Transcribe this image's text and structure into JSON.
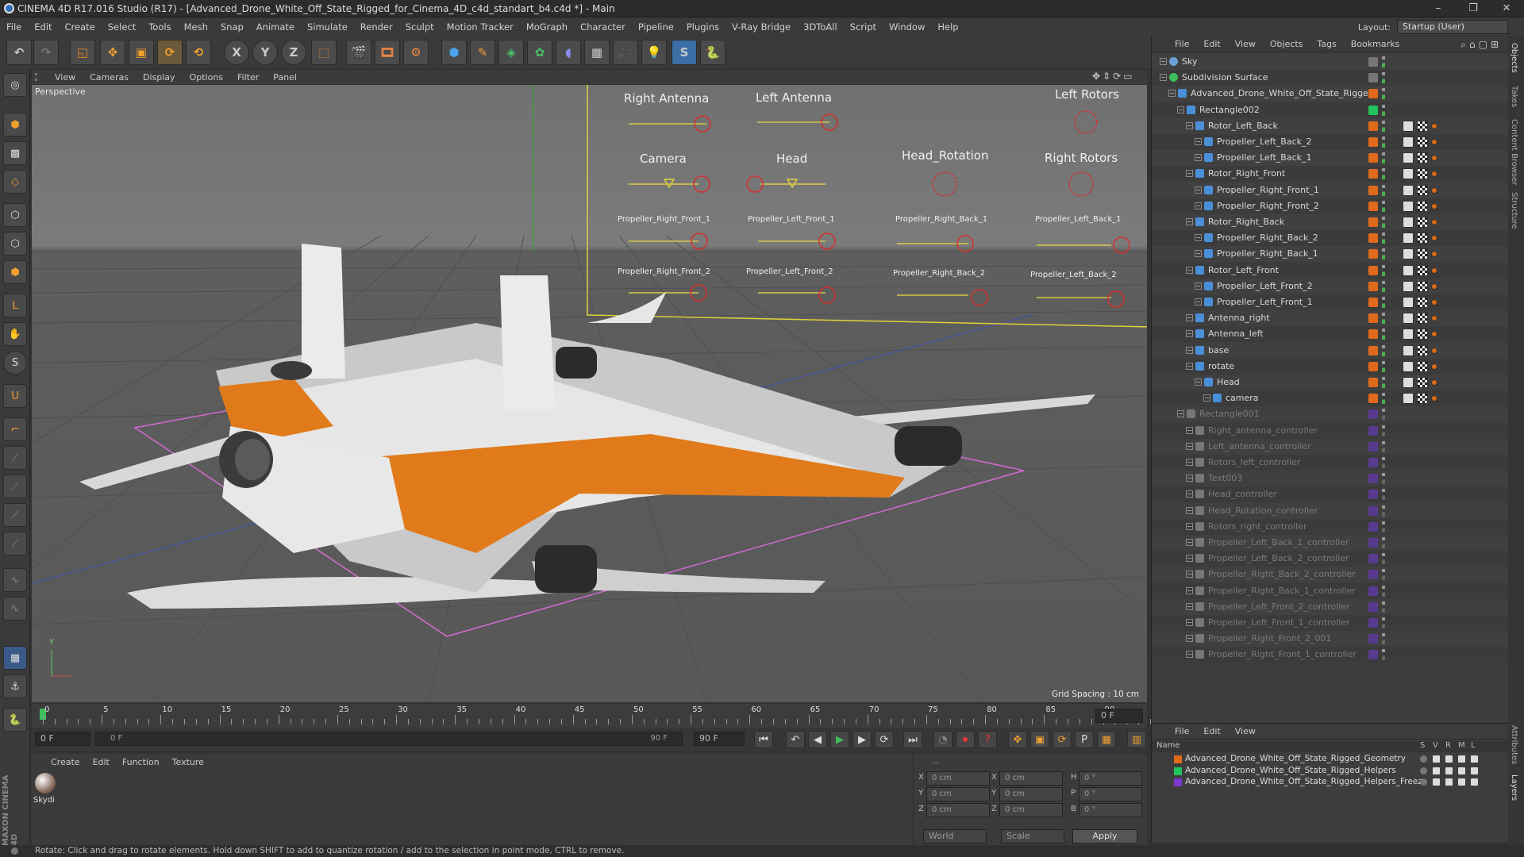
{
  "window": {
    "title": "CINEMA 4D R17.016 Studio (R17) - [Advanced_Drone_White_Off_State_Rigged_for_Cinema_4D_c4d_standart_b4.c4d *] - Main",
    "min": "–",
    "max": "❐",
    "close": "✕"
  },
  "menu": [
    "File",
    "Edit",
    "Create",
    "Select",
    "Tools",
    "Mesh",
    "Snap",
    "Animate",
    "Simulate",
    "Render",
    "Sculpt",
    "Motion Tracker",
    "MoGraph",
    "Character",
    "Pipeline",
    "Plugins",
    "V-Ray Bridge",
    "3DToAll",
    "Script",
    "Window",
    "Help"
  ],
  "layout": {
    "label": "Layout:",
    "value": "Startup (User)"
  },
  "toolbar": {
    "x": "X",
    "y": "Y",
    "z": "Z"
  },
  "viewport": {
    "menu": [
      "View",
      "Cameras",
      "Display",
      "Options",
      "Filter",
      "Panel"
    ],
    "label": "Perspective",
    "grid_spacing": "Grid Spacing : 10 cm",
    "axis_y": "Y",
    "controllers": [
      {
        "label": "Right Antenna"
      },
      {
        "label": "Left Antenna"
      },
      {
        "label": "Left Rotors"
      },
      {
        "label": "Camera"
      },
      {
        "label": "Head"
      },
      {
        "label": "Head_Rotation"
      },
      {
        "label": "Right Rotors"
      },
      {
        "label": "Propeller_Right_Front_1"
      },
      {
        "label": "Propeller_Left_Front_1"
      },
      {
        "label": "Propeller_Right_Back_1"
      },
      {
        "label": "Propeller_Left_Back_1"
      },
      {
        "label": "Propeller_Right_Front_2"
      },
      {
        "label": "Propeller_Left_Front_2"
      },
      {
        "label": "Propeller_Right_Back_2"
      },
      {
        "label": "Propeller_Left_Back_2"
      }
    ]
  },
  "timeline": {
    "ticks": [
      "0",
      "5",
      "10",
      "15",
      "20",
      "25",
      "30",
      "35",
      "40",
      "45",
      "50",
      "55",
      "60",
      "65",
      "70",
      "75",
      "80",
      "85",
      "90"
    ],
    "current": "0 F",
    "start": "0 F",
    "range_start": "0 F",
    "range_end": "90 F",
    "end": "90 F"
  },
  "material": {
    "menu": [
      "Create",
      "Edit",
      "Function",
      "Texture"
    ],
    "items": [
      {
        "name": "Skydi"
      }
    ]
  },
  "coords": {
    "header": "--",
    "rows": [
      {
        "a": "X",
        "a_val": "0 cm",
        "b": "X",
        "b_val": "0 cm",
        "c": "H",
        "c_val": "0 °"
      },
      {
        "a": "Y",
        "a_val": "0 cm",
        "b": "Y",
        "b_val": "0 cm",
        "c": "P",
        "c_val": "0 °"
      },
      {
        "a": "Z",
        "a_val": "0 cm",
        "b": "Z",
        "b_val": "0 cm",
        "c": "B",
        "c_val": "0 °"
      }
    ],
    "mode": "World",
    "type": "Scale",
    "apply": "Apply"
  },
  "objects": {
    "menu": [
      "File",
      "Edit",
      "View",
      "Objects",
      "Tags",
      "Bookmarks"
    ],
    "rows": [
      {
        "name": "Sky",
        "indent": 0,
        "dim": false,
        "tag": "none"
      },
      {
        "name": "Subdivision Surface",
        "indent": 0,
        "dim": false,
        "tag": "none"
      },
      {
        "name": "Advanced_Drone_White_Off_State_Rigged",
        "indent": 1,
        "dim": false,
        "tag": "orange"
      },
      {
        "name": "Rectangle002",
        "indent": 2,
        "dim": false,
        "tag": "green"
      },
      {
        "name": "Rotor_Left_Back",
        "indent": 3,
        "dim": false,
        "tag": "orange"
      },
      {
        "name": "Propeller_Left_Back_2",
        "indent": 4,
        "dim": false,
        "tag": "orange"
      },
      {
        "name": "Propeller_Left_Back_1",
        "indent": 4,
        "dim": false,
        "tag": "orange"
      },
      {
        "name": "Rotor_Right_Front",
        "indent": 3,
        "dim": false,
        "tag": "orange"
      },
      {
        "name": "Propeller_Right_Front_1",
        "indent": 4,
        "dim": false,
        "tag": "orange"
      },
      {
        "name": "Propeller_Right_Front_2",
        "indent": 4,
        "dim": false,
        "tag": "orange"
      },
      {
        "name": "Rotor_Right_Back",
        "indent": 3,
        "dim": false,
        "tag": "orange"
      },
      {
        "name": "Propeller_Right_Back_2",
        "indent": 4,
        "dim": false,
        "tag": "orange"
      },
      {
        "name": "Propeller_Right_Back_1",
        "indent": 4,
        "dim": false,
        "tag": "orange"
      },
      {
        "name": "Rotor_Left_Front",
        "indent": 3,
        "dim": false,
        "tag": "orange"
      },
      {
        "name": "Propeller_Left_Front_2",
        "indent": 4,
        "dim": false,
        "tag": "orange"
      },
      {
        "name": "Propeller_Left_Front_1",
        "indent": 4,
        "dim": false,
        "tag": "orange"
      },
      {
        "name": "Antenna_right",
        "indent": 3,
        "dim": false,
        "tag": "orange"
      },
      {
        "name": "Antenna_left",
        "indent": 3,
        "dim": false,
        "tag": "orange"
      },
      {
        "name": "base",
        "indent": 3,
        "dim": false,
        "tag": "orange"
      },
      {
        "name": "rotate",
        "indent": 3,
        "dim": false,
        "tag": "orange"
      },
      {
        "name": "Head",
        "indent": 4,
        "dim": false,
        "tag": "orange"
      },
      {
        "name": "camera",
        "indent": 5,
        "dim": false,
        "tag": "orange"
      },
      {
        "name": "Rectangle001",
        "indent": 2,
        "dim": true,
        "tag": "purple"
      },
      {
        "name": "Right_antenna_controller",
        "indent": 3,
        "dim": true,
        "tag": "purple"
      },
      {
        "name": "Left_antenna_controller",
        "indent": 3,
        "dim": true,
        "tag": "purple"
      },
      {
        "name": "Rotors_left_controller",
        "indent": 3,
        "dim": true,
        "tag": "purple"
      },
      {
        "name": "Text003",
        "indent": 3,
        "dim": true,
        "tag": "purple"
      },
      {
        "name": "Head_controller",
        "indent": 3,
        "dim": true,
        "tag": "purple"
      },
      {
        "name": "Head_Rotation_controller",
        "indent": 3,
        "dim": true,
        "tag": "purple"
      },
      {
        "name": "Rotors_right_controller",
        "indent": 3,
        "dim": true,
        "tag": "purple"
      },
      {
        "name": "Propeller_Left_Back_1_controller",
        "indent": 3,
        "dim": true,
        "tag": "purple"
      },
      {
        "name": "Propeller_Left_Back_2_controller",
        "indent": 3,
        "dim": true,
        "tag": "purple"
      },
      {
        "name": "Propeller_Right_Back_2_controller",
        "indent": 3,
        "dim": true,
        "tag": "purple"
      },
      {
        "name": "Propeller_Right_Back_1_controller",
        "indent": 3,
        "dim": true,
        "tag": "purple"
      },
      {
        "name": "Propeller_Left_Front_2_controller",
        "indent": 3,
        "dim": true,
        "tag": "purple"
      },
      {
        "name": "Propeller_Left_Front_1_controller",
        "indent": 3,
        "dim": true,
        "tag": "purple"
      },
      {
        "name": "Propeller_Right_Front_2_001",
        "indent": 3,
        "dim": true,
        "tag": "purple"
      },
      {
        "name": "Propeller_Right_Front_1_controller",
        "indent": 3,
        "dim": true,
        "tag": "purple"
      }
    ]
  },
  "layers": {
    "menu": [
      "File",
      "Edit",
      "View"
    ],
    "header": "Name",
    "cols": [
      "S",
      "V",
      "R",
      "M",
      "L"
    ],
    "rows": [
      {
        "name": "Advanced_Drone_White_Off_State_Rigged_Geometry",
        "color": "#e06a1c"
      },
      {
        "name": "Advanced_Drone_White_Off_State_Rigged_Helpers",
        "color": "#21c45a"
      },
      {
        "name": "Advanced_Drone_White_Off_State_Rigged_Helpers_Freeze",
        "color": "#7a3bd1"
      }
    ]
  },
  "side_tabs": [
    "Objects",
    "Takes",
    "Content Browser",
    "Structure"
  ],
  "side_tabs_bottom": [
    "Attributes",
    "Layers"
  ],
  "status": "Rotate: Click and drag to rotate elements. Hold down SHIFT to add to quantize rotation / add to the selection in point mode, CTRL to remove.",
  "brand": "MAXON CINEMA 4D"
}
